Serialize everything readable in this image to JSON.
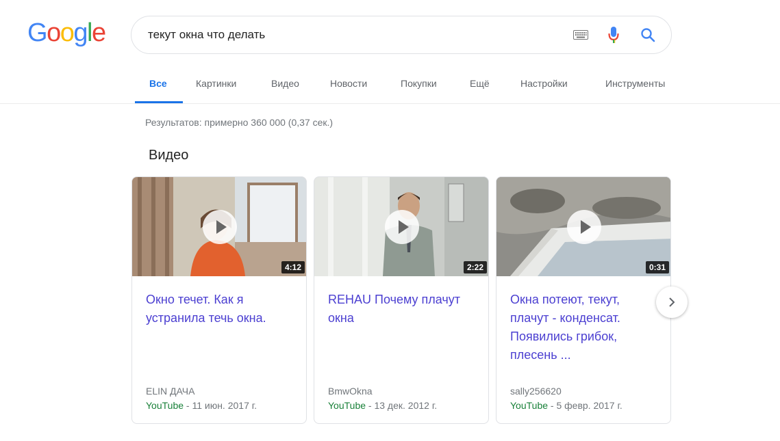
{
  "logo": {
    "letters": [
      {
        "char": "G",
        "color": "#4285F4"
      },
      {
        "char": "o",
        "color": "#EA4335"
      },
      {
        "char": "o",
        "color": "#FBBC05"
      },
      {
        "char": "g",
        "color": "#4285F4"
      },
      {
        "char": "l",
        "color": "#34A853"
      },
      {
        "char": "e",
        "color": "#EA4335"
      }
    ]
  },
  "search": {
    "query": "текут окна что делать",
    "icons": [
      "keyboard-icon",
      "mic-icon",
      "search-icon"
    ]
  },
  "tabs": [
    {
      "label": "Все",
      "active": true
    },
    {
      "label": "Картинки",
      "active": false
    },
    {
      "label": "Видео",
      "active": false
    },
    {
      "label": "Новости",
      "active": false
    },
    {
      "label": "Покупки",
      "active": false
    },
    {
      "label": "Ещё",
      "active": false
    },
    {
      "label": "Настройки",
      "active": false
    },
    {
      "label": "Инструменты",
      "active": false
    }
  ],
  "result_stats": "Результатов: примерно 360 000 (0,37 сек.)",
  "videos_section": {
    "heading": "Видео",
    "cards": [
      {
        "duration": "4:12",
        "title": "Окно течет. Как я устранила течь окна.",
        "channel": "ELIN ДАЧА",
        "source": "YouTube",
        "date": " - 11 июн. 2017 г."
      },
      {
        "duration": "2:22",
        "title": "REHAU Почему плачут окна",
        "channel": "BmwOkna",
        "source": "YouTube",
        "date": " - 13 дек. 2012 г."
      },
      {
        "duration": "0:31",
        "title": "Окна потеют, текут, плачут - конденсат. Появились грибок, плесень ...",
        "channel": "sally256620",
        "source": "YouTube",
        "date": " - 5 февр. 2017 г."
      }
    ],
    "next_icon": "chevron-right-icon"
  },
  "colors": {
    "accent": "#1a73e8",
    "link": "#4b3fd1",
    "source_green": "#188038",
    "muted": "#70757a"
  }
}
